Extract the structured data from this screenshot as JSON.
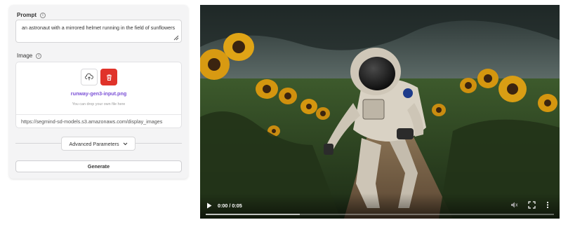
{
  "form": {
    "prompt": {
      "label": "Prompt",
      "value": "an astronaut with a mirrored helmet running in the field of sunflowers"
    },
    "image": {
      "label": "Image",
      "filename": "runway-gen3-input.png",
      "drop_hint": "You can drop your own file here",
      "url": "https://segmind-sd-models.s3.amazonaws.com/display_images"
    },
    "advanced_label": "Advanced Parameters",
    "generate_label": "Generate"
  },
  "video": {
    "time": "0:00 / 0:05",
    "buffered_fraction": 0.27,
    "scene": "astronaut running through sunflower field"
  },
  "colors": {
    "delete_button": "#e0332a",
    "filename_link": "#7a4fd6",
    "panel_bg": "#f4f4f5"
  },
  "icons": [
    "info-icon",
    "resize-icon",
    "upload-icon",
    "trash-icon",
    "chevron-down-icon",
    "play-icon",
    "volume-icon",
    "fullscreen-icon",
    "more-vertical-icon"
  ]
}
